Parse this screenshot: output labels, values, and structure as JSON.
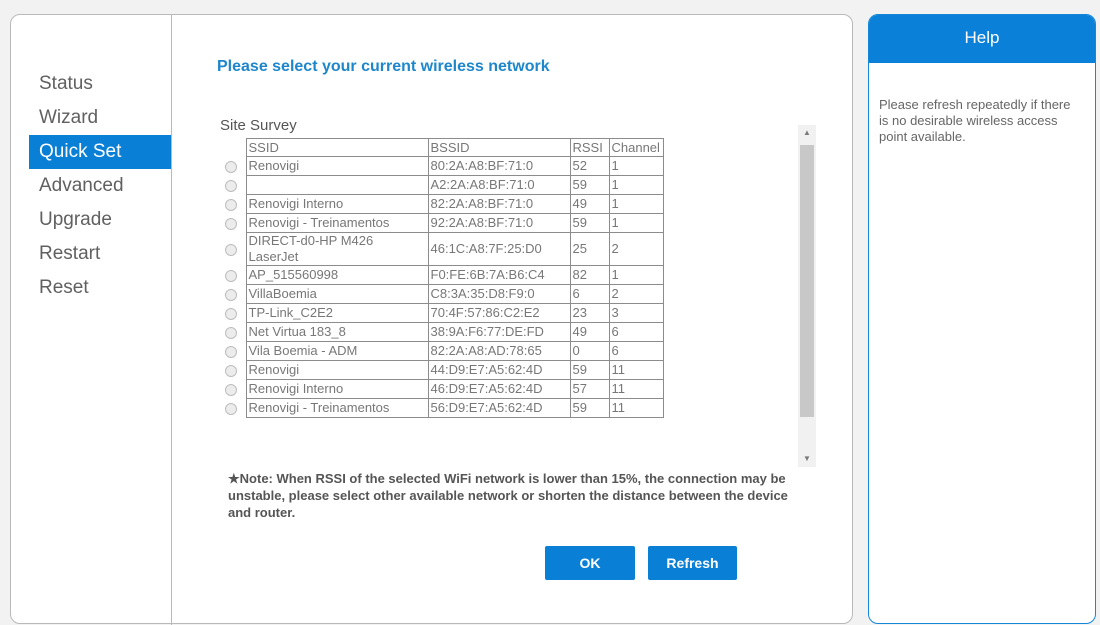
{
  "nav": {
    "items": [
      {
        "label": "Status",
        "active": false
      },
      {
        "label": "Wizard",
        "active": false
      },
      {
        "label": "Quick Set",
        "active": true
      },
      {
        "label": "Advanced",
        "active": false
      },
      {
        "label": "Upgrade",
        "active": false
      },
      {
        "label": "Restart",
        "active": false
      },
      {
        "label": "Reset",
        "active": false
      }
    ]
  },
  "main": {
    "heading": "Please select your current wireless network",
    "survey_label": "Site Survey",
    "columns": [
      "SSID",
      "BSSID",
      "RSSI",
      "Channel"
    ],
    "networks": [
      {
        "ssid": "Renovigi",
        "bssid": "80:2A:A8:BF:71:0",
        "rssi": "52",
        "channel": "1"
      },
      {
        "ssid": "",
        "bssid": "A2:2A:A8:BF:71:0",
        "rssi": "59",
        "channel": "1"
      },
      {
        "ssid": "Renovigi Interno",
        "bssid": "82:2A:A8:BF:71:0",
        "rssi": "49",
        "channel": "1"
      },
      {
        "ssid": "Renovigi - Treinamentos",
        "bssid": "92:2A:A8:BF:71:0",
        "rssi": "59",
        "channel": "1"
      },
      {
        "ssid": "DIRECT-d0-HP M426 LaserJet",
        "bssid": "46:1C:A8:7F:25:D0",
        "rssi": "25",
        "channel": "2"
      },
      {
        "ssid": "AP_515560998",
        "bssid": "F0:FE:6B:7A:B6:C4",
        "rssi": "82",
        "channel": "1"
      },
      {
        "ssid": "VillaBoemia",
        "bssid": "C8:3A:35:D8:F9:0",
        "rssi": "6",
        "channel": "2"
      },
      {
        "ssid": "TP-Link_C2E2",
        "bssid": "70:4F:57:86:C2:E2",
        "rssi": "23",
        "channel": "3"
      },
      {
        "ssid": "Net Virtua 183_8",
        "bssid": "38:9A:F6:77:DE:FD",
        "rssi": "49",
        "channel": "6"
      },
      {
        "ssid": "Vila Boemia - ADM",
        "bssid": "82:2A:A8:AD:78:65",
        "rssi": "0",
        "channel": "6"
      },
      {
        "ssid": "Renovigi",
        "bssid": "44:D9:E7:A5:62:4D",
        "rssi": "59",
        "channel": "11"
      },
      {
        "ssid": "Renovigi Interno",
        "bssid": "46:D9:E7:A5:62:4D",
        "rssi": "57",
        "channel": "11"
      },
      {
        "ssid": "Renovigi - Treinamentos",
        "bssid": "56:D9:E7:A5:62:4D",
        "rssi": "59",
        "channel": "11"
      }
    ],
    "note": "★Note: When RSSI of the selected WiFi network is lower than 15%, the connection may be unstable, please select other available network or shorten the distance between the device and router.",
    "ok_label": "OK",
    "refresh_label": "Refresh"
  },
  "help": {
    "title": "Help",
    "text": "Please refresh repeatedly if there is no desirable wireless access point available."
  },
  "colors": {
    "accent": "#0a7fd6",
    "heading": "#1e87cc"
  }
}
